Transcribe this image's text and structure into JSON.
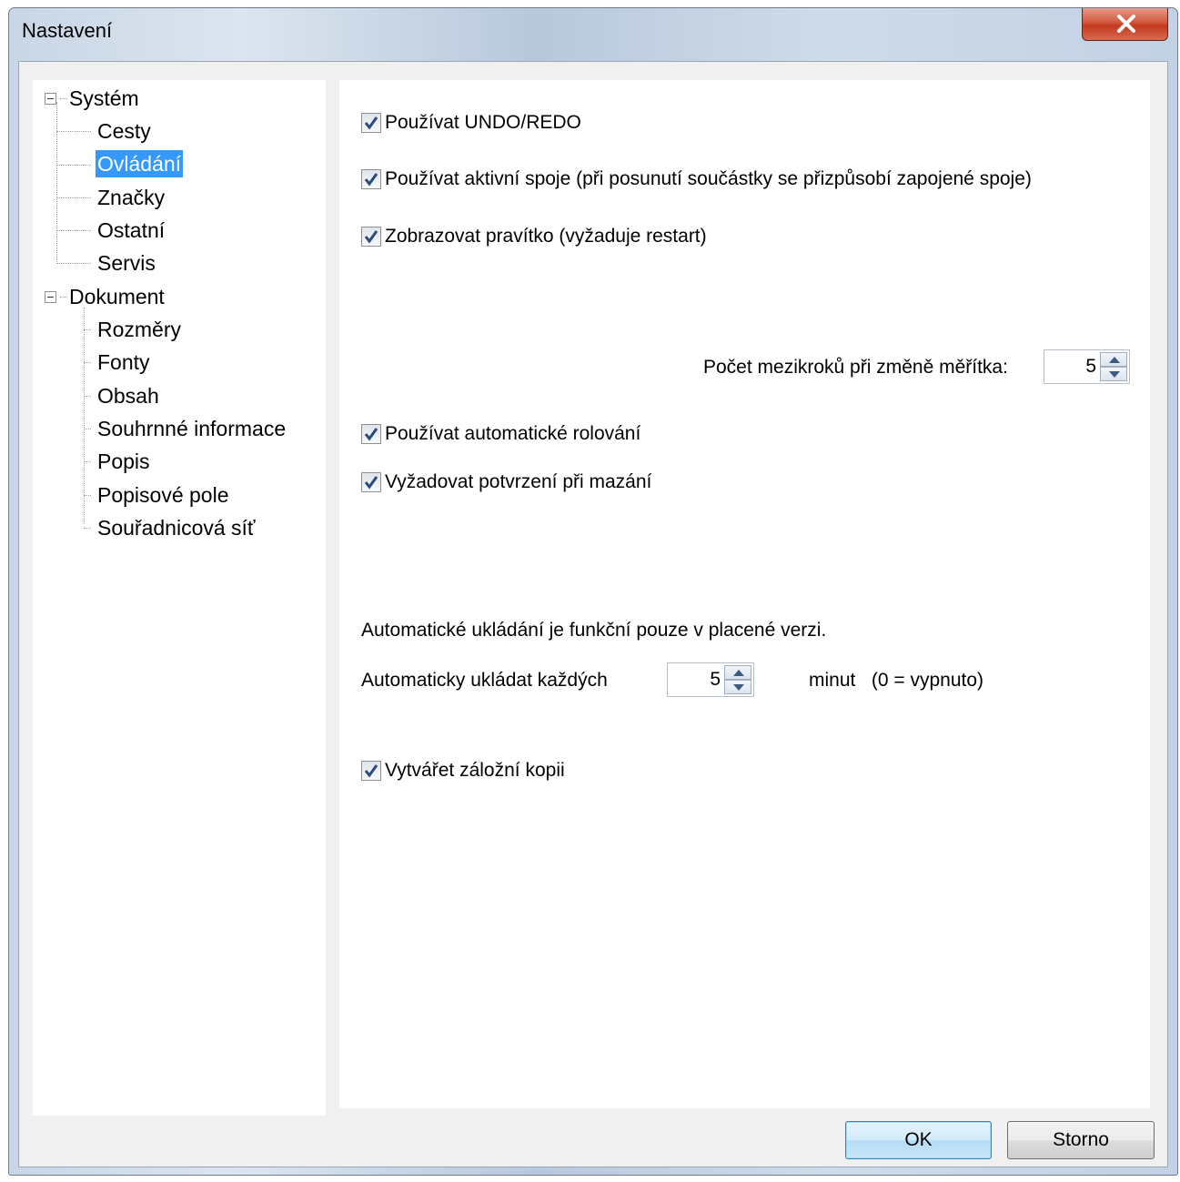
{
  "window": {
    "title": "Nastavení"
  },
  "tree": {
    "groups": [
      {
        "label": "Systém",
        "items": [
          "Cesty",
          "Ovládání",
          "Značky",
          "Ostatní",
          "Servis"
        ]
      },
      {
        "label": "Dokument",
        "items": [
          "Rozměry",
          "Fonty",
          "Obsah",
          "Souhrnné informace",
          "Popis",
          "Popisové pole",
          "Souřadnicová síť"
        ]
      }
    ],
    "selected": "Ovládání"
  },
  "options": {
    "undo_redo": {
      "label": "Používat UNDO/REDO",
      "checked": true
    },
    "active_links": {
      "label": "Používat aktivní spoje (při posunutí součástky se  přizpůsobí zapojené spoje)",
      "checked": true
    },
    "ruler": {
      "label": "Zobrazovat pravítko (vyžaduje restart)",
      "checked": true
    },
    "zoom_steps": {
      "label": "Počet mezikroků při změně měřítka:",
      "value": "5"
    },
    "auto_scroll": {
      "label": "Používat automatické rolování",
      "checked": true
    },
    "confirm_delete": {
      "label": "Vyžadovat potvrzení při mazání",
      "checked": true
    },
    "autosave_note": "Automatické ukládání je funkční pouze v placené verzi.",
    "autosave": {
      "label": "Automaticky ukládat každých",
      "value": "5",
      "suffix": "minut   (0 = vypnuto)"
    },
    "backup": {
      "label": "Vytvářet záložní kopii",
      "checked": true
    }
  },
  "buttons": {
    "ok": "OK",
    "cancel": "Storno"
  }
}
